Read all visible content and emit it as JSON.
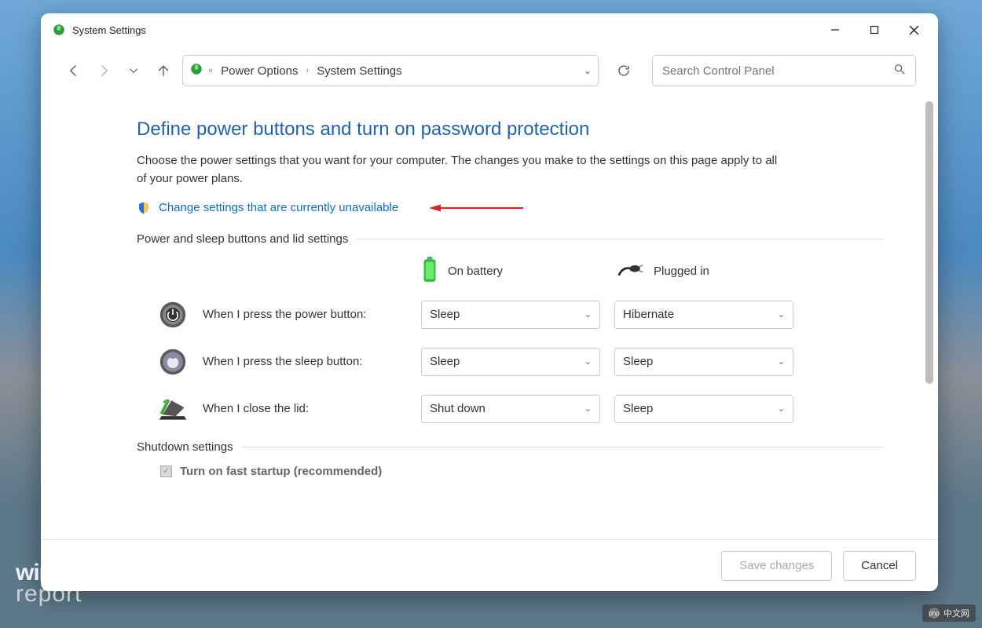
{
  "window": {
    "title": "System Settings"
  },
  "breadcrumb": {
    "item1": "Power Options",
    "item2": "System Settings"
  },
  "search": {
    "placeholder": "Search Control Panel"
  },
  "page": {
    "heading": "Define power buttons and turn on password protection",
    "description": "Choose the power settings that you want for your computer. The changes you make to the settings on this page apply to all of your power plans.",
    "change_link": "Change settings that are currently unavailable"
  },
  "sections": {
    "power_sleep_label": "Power and sleep buttons and lid settings",
    "shutdown_label": "Shutdown settings"
  },
  "columns": {
    "battery": "On battery",
    "plugged": "Plugged in"
  },
  "rows": {
    "power_button": {
      "label": "When I press the power button:",
      "battery": "Sleep",
      "plugged": "Hibernate"
    },
    "sleep_button": {
      "label": "When I press the sleep button:",
      "battery": "Sleep",
      "plugged": "Sleep"
    },
    "close_lid": {
      "label": "When I close the lid:",
      "battery": "Shut down",
      "plugged": "Sleep"
    }
  },
  "shutdown": {
    "fast_startup": "Turn on fast startup (recommended)"
  },
  "footer": {
    "save": "Save changes",
    "cancel": "Cancel"
  },
  "watermark": {
    "l1": "windows",
    "l2": "report"
  },
  "badge": {
    "text": "中文网"
  }
}
